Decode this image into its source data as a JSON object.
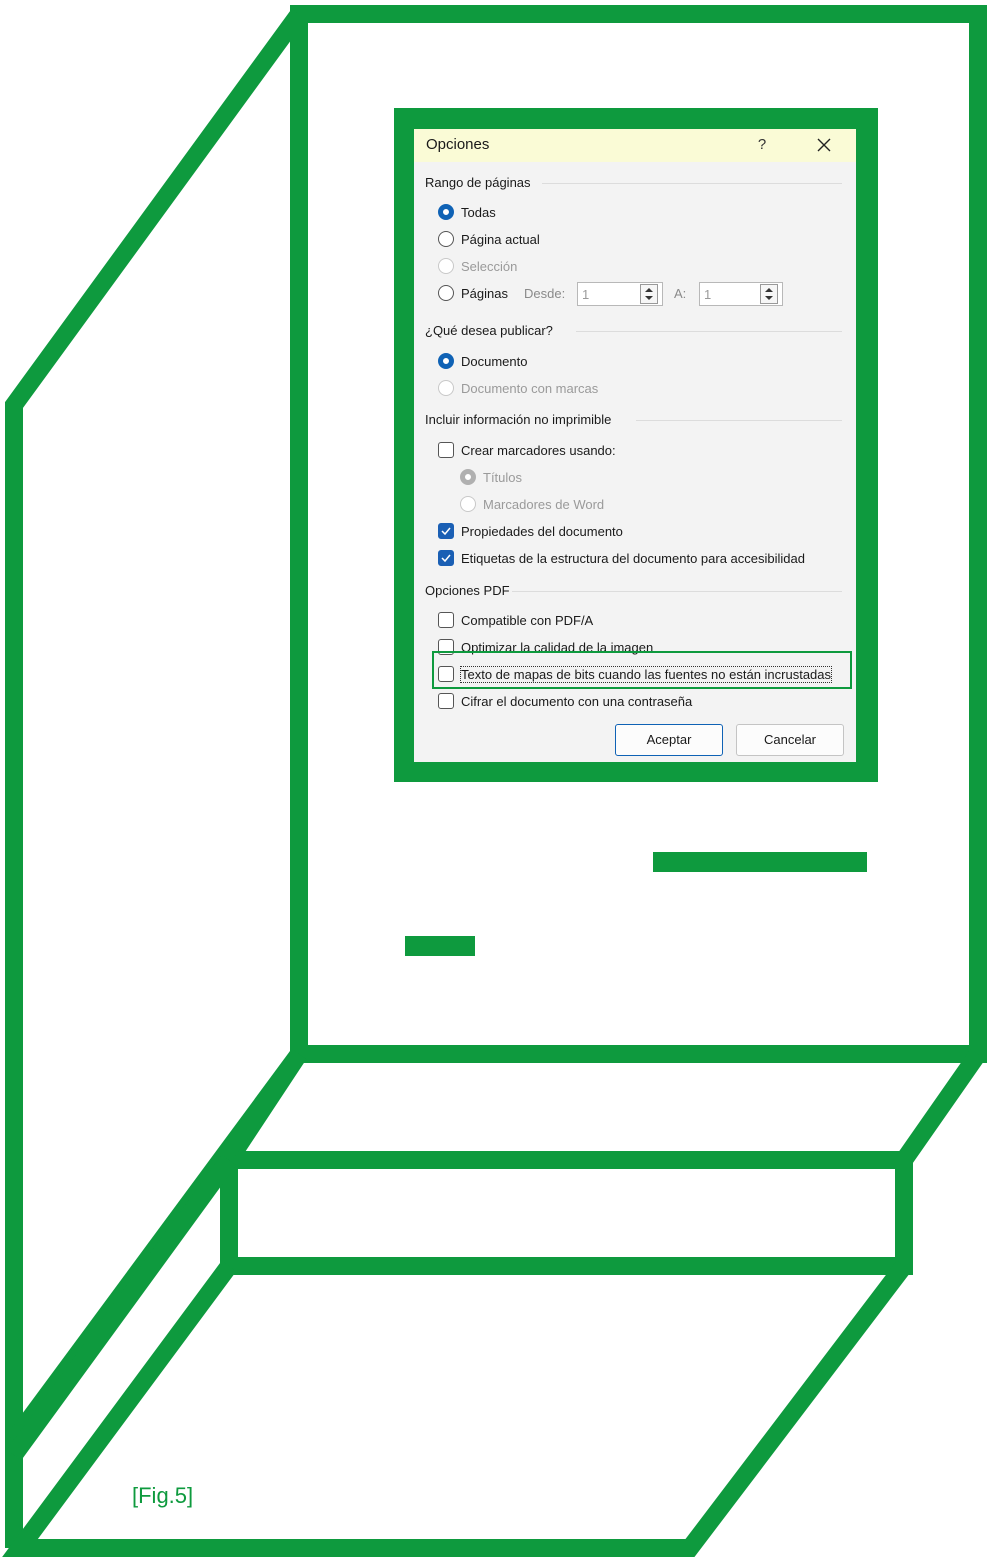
{
  "colors": {
    "accent_green": "#0e9a3e",
    "radio_blue": "#0f62b5",
    "title_bg": "#fafbd6"
  },
  "figure_caption": "[Fig.5]",
  "dialog": {
    "title": "Opciones",
    "help_label": "?",
    "close_icon": "close-icon",
    "page_range": {
      "heading": "Rango de páginas",
      "all": "Todas",
      "current_page": "Página actual",
      "selection": "Selección",
      "pages": "Páginas",
      "from_label": "Desde:",
      "from_value": "1",
      "to_label": "A:",
      "to_value": "1",
      "selected": "Todas"
    },
    "publish": {
      "heading": "¿Qué desea publicar?",
      "document": "Documento",
      "document_markup": "Documento con marcas",
      "selected": "Documento"
    },
    "nonprint": {
      "heading": "Incluir información no imprimible",
      "create_bookmarks": "Crear marcadores usando:",
      "create_bookmarks_checked": false,
      "headings": "Títulos",
      "word_bookmarks": "Marcadores de Word",
      "doc_properties": "Propiedades del documento",
      "doc_properties_checked": true,
      "structure_tags": "Etiquetas de la estructura del documento para accesibilidad",
      "structure_tags_checked": true
    },
    "pdf_options": {
      "heading": "Opciones PDF",
      "pdfa": "Compatible con PDF/A",
      "pdfa_checked": false,
      "optimize_image": "Optimizar la calidad de la imagen",
      "optimize_image_checked": false,
      "bitmap_text": "Texto de mapas de bits cuando las fuentes no están incrustadas",
      "bitmap_text_checked": false,
      "encrypt": "Cifrar el documento con una contraseña",
      "encrypt_checked": false
    },
    "ok_label": "Aceptar",
    "cancel_label": "Cancelar"
  }
}
